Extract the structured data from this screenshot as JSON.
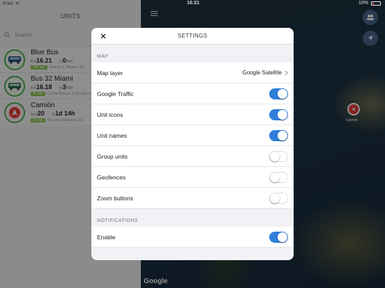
{
  "status": {
    "device": "iPad",
    "time": "16:21",
    "battery": "10%"
  },
  "left_panel": {
    "title": "UNITS",
    "search_placeholder": "Search",
    "units": [
      {
        "name": "Blue Bus",
        "speed": "16.21",
        "speed_unit": "km",
        "time": "0",
        "time_unit": "min",
        "ago": "14s ago",
        "address": "Main St 1, Mission, MI"
      },
      {
        "name": "Bus 32 Miami",
        "speed": "16.18",
        "speed_unit": "km",
        "time": "3",
        "time_unit": "min",
        "ago": "4s ago",
        "address": "Collins Avenue 2100, Miami"
      },
      {
        "name": "Camión",
        "speed": "20",
        "speed_unit": "kud",
        "time": "1d 14h",
        "time_unit": "",
        "ago": "2s ago",
        "address": "Rúa das Balanzas, Se..."
      }
    ]
  },
  "map": {
    "marker_label": "Camión",
    "attribution": "Google"
  },
  "settings": {
    "title": "SETTINGS",
    "map_section": "MAP",
    "map_layer_label": "Map layer",
    "map_layer_value": "Google Satellite",
    "toggles": [
      {
        "label": "Google Traffic",
        "on": true
      },
      {
        "label": "Unit icons",
        "on": true
      },
      {
        "label": "Unit names",
        "on": true
      },
      {
        "label": "Group units",
        "on": false
      },
      {
        "label": "Geofences",
        "on": false
      },
      {
        "label": "Zoom buttons",
        "on": false
      }
    ],
    "notifications_section": "NOTIFICATIONS",
    "enable_label": "Enable",
    "enable_on": true
  },
  "colors": {
    "accent": "#2f7fdb",
    "unit_ring": "#4caf50",
    "marker": "#e53935"
  }
}
